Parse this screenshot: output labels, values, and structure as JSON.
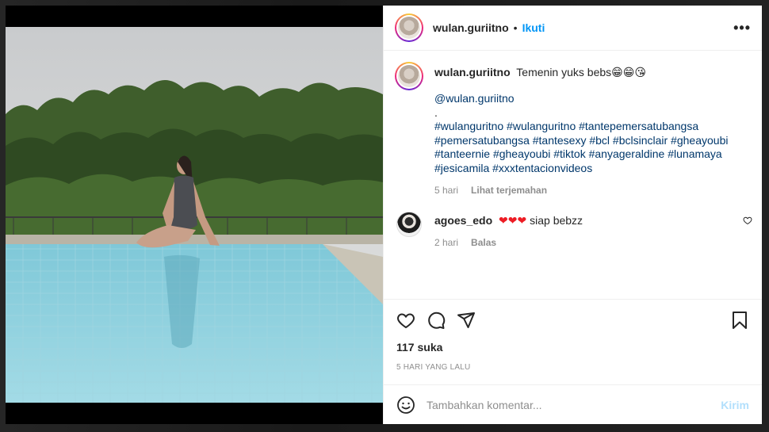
{
  "post": {
    "username": "wulan.guriitno",
    "follow_label": "Ikuti",
    "separator": "•",
    "more_label": "•••"
  },
  "caption": {
    "username": "wulan.guriitno",
    "text": "Temenin yuks bebs😁😁😘",
    "mention": "@wulan.guriitno",
    "period": ".",
    "hashtag_lines": [
      "#wulanguritno #wulanguritno #tantepemersatubangsa",
      "#pemersatubangsa #tantesexy #bcl #bclsinclair #gheayoubi",
      "#tanteernie #gheayoubi #tiktok #anyageraldine #lunamaya",
      "#jesicamila #xxxtentacionvideos"
    ],
    "time": "5 hari",
    "translate_label": "Lihat terjemahan"
  },
  "reply": {
    "username": "agoes_edo",
    "hearts": "❤❤❤",
    "text": "siap bebzz",
    "time": "2 hari",
    "reply_label": "Balas"
  },
  "actions": {
    "likes": "117 suka",
    "ago": "5 HARI YANG LALU"
  },
  "comment_box": {
    "placeholder": "Tambahkan komentar...",
    "post_label": "Kirim"
  },
  "colors": {
    "link": "#0095f6",
    "hashtag": "#00376b",
    "muted": "#8e8e8e",
    "heart": "#ed1c24"
  }
}
